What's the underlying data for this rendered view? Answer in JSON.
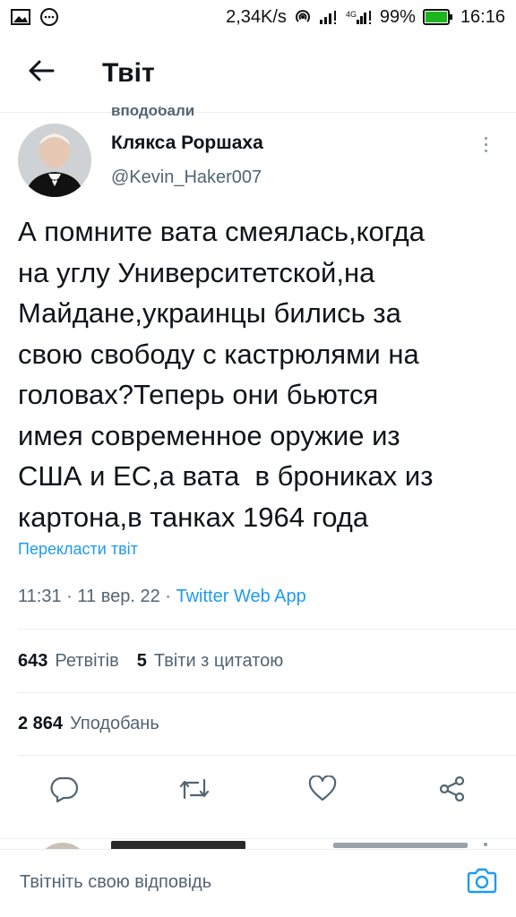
{
  "status_bar": {
    "speed": "2,34K/s",
    "network": "4G",
    "battery": "99%",
    "time": "16:16",
    "icons": [
      "image-icon",
      "chat-bubble-icon",
      "hotspot-icon",
      "signal-icon",
      "signal-4g-icon",
      "battery-icon"
    ]
  },
  "header": {
    "title": "Твіт",
    "back_icon": "arrow-left-icon"
  },
  "tweet": {
    "social_context": "вподобали",
    "author_name": "Клякса Роршаха",
    "author_handle": "@Kevin_Haker007",
    "text_lines": [
      "А помните вата смеялась,когда",
      "на углу Университетской,на",
      "Майдане,украинцы бились за",
      "свою свободу с кастрюлями на",
      "головах?Теперь они бьются",
      "имея современное оружие из",
      "США и ЕС,а вата  в брониках из",
      "картона,в танках 1964 года"
    ],
    "translate_label": "Перекласти твіт",
    "time": "11:31",
    "date": "11 вер. 22",
    "separator": "·",
    "source": "Twitter Web App",
    "retweets_count": "643",
    "retweets_label": "Ретвітів",
    "quotes_count": "5",
    "quotes_label": "Твіти з цитатою",
    "likes_count": "2 864",
    "likes_label": "Уподобань"
  },
  "actions": [
    "reply-icon",
    "retweet-icon",
    "like-icon",
    "share-icon"
  ],
  "reply_bar": {
    "placeholder": "Твітніть свою відповідь",
    "camera_icon": "camera-icon"
  },
  "colors": {
    "accent": "#1d9bf0",
    "secondary_text": "#536471",
    "primary_text": "#0f1419",
    "divider": "#eceef0"
  }
}
